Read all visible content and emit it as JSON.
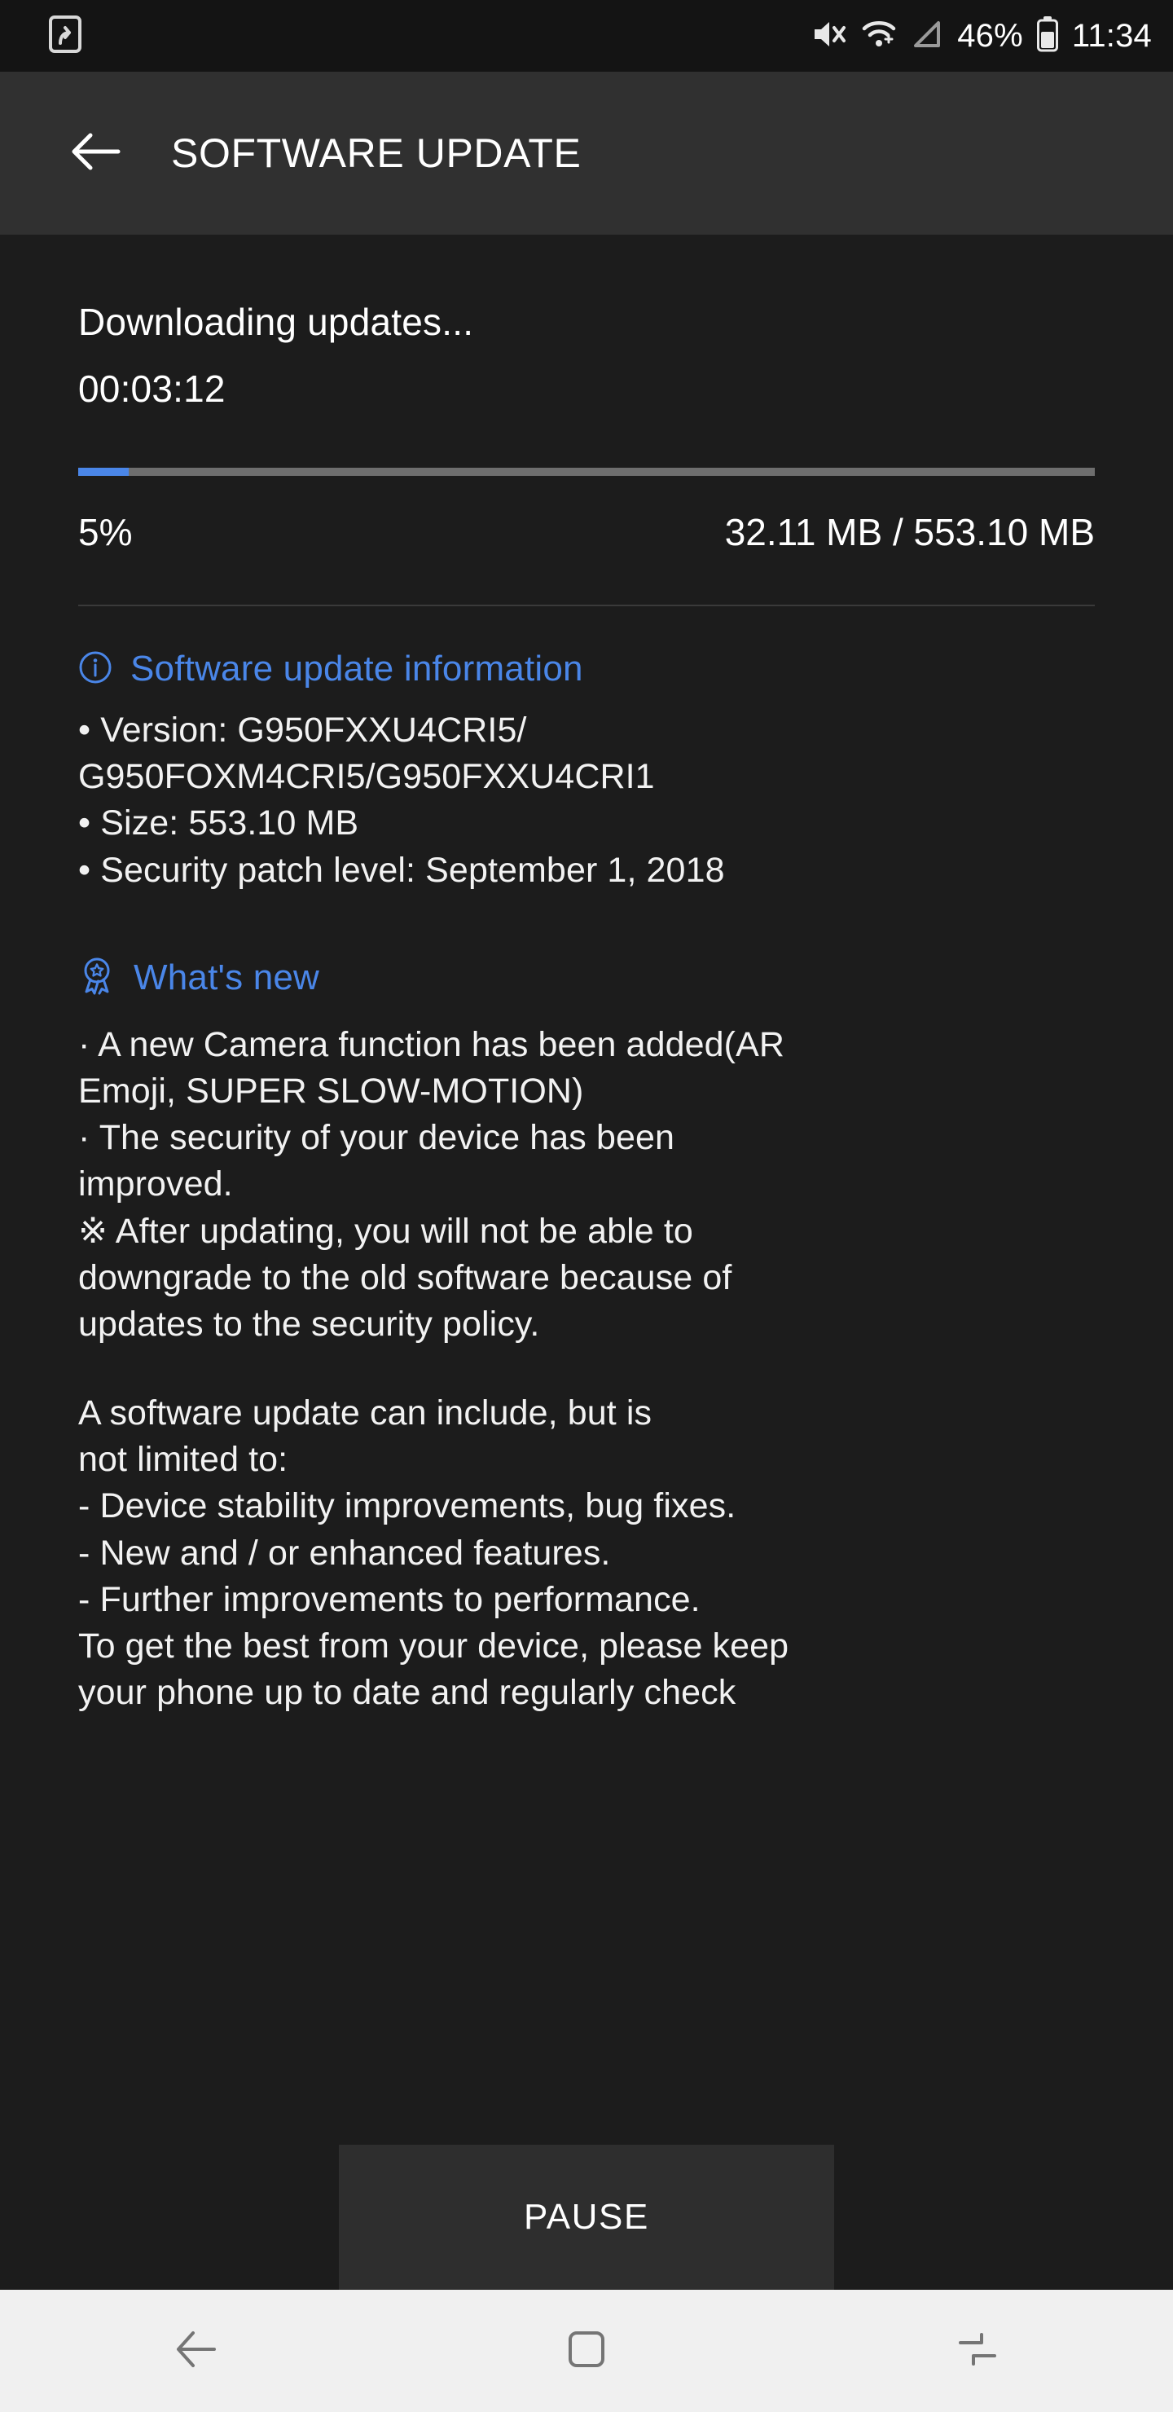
{
  "status_bar": {
    "notification_icon": "software-update-icon",
    "mute_icon": "volume-mute-icon",
    "wifi_icon": "wifi-icon",
    "signal_icon": "cellular-signal-icon",
    "battery_percent": "46%",
    "battery_icon": "battery-icon",
    "time": "11:34"
  },
  "app_bar": {
    "back_icon": "back-arrow-icon",
    "title": "SOFTWARE UPDATE"
  },
  "download": {
    "status_text": "Downloading updates...",
    "elapsed_time": "00:03:12",
    "percent_label": "5%",
    "percent_value": 5,
    "size_progress": "32.11 MB / 553.10 MB",
    "downloaded": "32.11 MB",
    "total": "553.10 MB",
    "bar_fill_color": "#4a86e8",
    "bar_track_color": "#6e6e6e"
  },
  "update_info": {
    "icon": "info-circle-icon",
    "heading": "Software update information",
    "accent_color": "#4a86e8",
    "lines": [
      "• Version: G950FXXU4CRI5/",
      "G950FOXM4CRI5/G950FXXU4CRI1",
      "• Size: 553.10 MB",
      "• Security patch level: September 1, 2018"
    ]
  },
  "whats_new": {
    "icon": "award-badge-icon",
    "heading": "What's new",
    "lines": [
      "· A new Camera function has been added(AR",
      "Emoji, SUPER SLOW-MOTION)",
      "· The security of your device has been",
      "improved.",
      "※ After updating, you will not be able to",
      "downgrade to the old software because of",
      "updates to the security policy."
    ],
    "lines2": [
      "A software update can include, but is",
      "not limited to:",
      " - Device stability improvements, bug fixes.",
      " - New and / or enhanced features.",
      " - Further improvements to performance.",
      "To get the best from your device, please keep",
      "your phone up to date and regularly check"
    ]
  },
  "actions": {
    "pause_label": "PAUSE"
  },
  "nav_bar": {
    "back_icon": "nav-back-icon",
    "home_icon": "nav-home-icon",
    "recents_icon": "nav-recents-icon"
  }
}
